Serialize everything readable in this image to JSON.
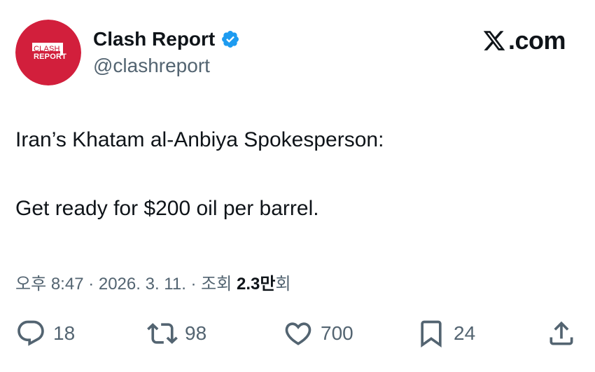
{
  "author": {
    "display_name": "Clash Report",
    "handle": "@clashreport",
    "verified": true,
    "avatar": {
      "line1": "CLASH",
      "line2": "REPORT",
      "color": "#d21f3c"
    }
  },
  "brand": {
    "text": ".com",
    "icon": "x-logo-icon"
  },
  "tweet": {
    "lines": [
      "Iran’s Khatam al-Anbiya Spokesperson:",
      "Get ready for $200 oil per barrel."
    ]
  },
  "meta": {
    "prefix": "오후 8:47 · 2026. 3. 11. · 조회 ",
    "views": "2.3만",
    "suffix": "회"
  },
  "actions": {
    "replies": "18",
    "reposts": "98",
    "likes": "700",
    "bookmarks": "24"
  },
  "colors": {
    "text": "#0f1419",
    "secondary": "#536471",
    "verified": "#1d9bf0",
    "avatar_red": "#d21f3c"
  }
}
